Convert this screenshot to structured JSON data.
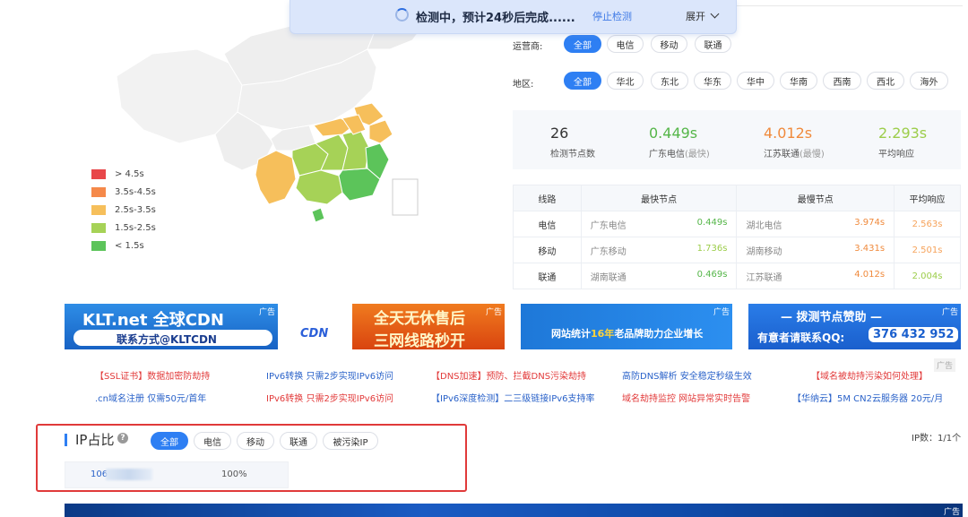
{
  "banner": {
    "status": "检测中，预计24秒后完成......",
    "stop": "停止检测",
    "expand": "展开"
  },
  "legend": [
    {
      "label": "> 4.5s",
      "color": "#e8474a"
    },
    {
      "label": "3.5s-4.5s",
      "color": "#f5894a"
    },
    {
      "label": "2.5s-3.5s",
      "color": "#f6bf5b"
    },
    {
      "label": "1.5s-2.5s",
      "color": "#a6d257"
    },
    {
      "label": "< 1.5s",
      "color": "#5cc45a"
    }
  ],
  "filters": {
    "isp_label": "运营商:",
    "isp": [
      "全部",
      "电信",
      "移动",
      "联通"
    ],
    "region_label": "地区:",
    "region": [
      "全部",
      "华北",
      "东北",
      "华东",
      "华中",
      "华南",
      "西南",
      "西北",
      "海外"
    ]
  },
  "stats": [
    {
      "value": "26",
      "label": "检测节点数",
      "note": "",
      "color": "#333333"
    },
    {
      "value": "0.449s",
      "label": "广东电信",
      "note": "(最快)",
      "color": "#55b649"
    },
    {
      "value": "4.012s",
      "label": "江苏联通",
      "note": "(最慢)",
      "color": "#f08a3c"
    },
    {
      "value": "2.293s",
      "label": "平均响应",
      "note": "",
      "color": "#9ccd4a"
    }
  ],
  "table": {
    "headers": [
      "线路",
      "最快节点",
      "最慢节点",
      "平均响应"
    ],
    "rows": [
      {
        "line": "电信",
        "fast_node": "广东电信",
        "fast_time": "0.449s",
        "slow_node": "湖北电信",
        "slow_time": "3.974s",
        "avg": "2.563s"
      },
      {
        "line": "移动",
        "fast_node": "广东移动",
        "fast_time": "1.736s",
        "slow_node": "湖南移动",
        "slow_time": "3.431s",
        "avg": "2.501s"
      },
      {
        "line": "联通",
        "fast_node": "湖南联通",
        "fast_time": "0.469s",
        "slow_node": "江苏联通",
        "slow_time": "4.012s",
        "avg": "2.004s"
      }
    ]
  },
  "ads": {
    "tag": "广告",
    "ad1_line1": "KLT.net 全球CDN",
    "ad1_line2": "联系方式@KLTCDN",
    "ad2_line1": "全天无休售后",
    "ad2_line2": "三网线路秒开",
    "ad2_logo": "CDN",
    "ad3_line1": "网站统计",
    "ad3_highlight": "16年",
    "ad3_line2": "老品牌助力企业增长",
    "ad4_line1": "— 拨测节点赞助 —",
    "ad4_line2": "有意者请联系QQ:",
    "ad4_qq": "376 432 952"
  },
  "text_ads": {
    "row1": [
      "【SSL证书】数据加密防劫持",
      "IPv6转换 只需2步实现IPv6访问",
      "【DNS加速】预防、拦截DNS污染劫持",
      "高防DNS解析 安全稳定秒级生效",
      "【域名被劫持污染如何处理】"
    ],
    "row2": [
      ".cn域名注册 仅需50元/首年",
      "IPv6转换 只需2步实现IPv6访问",
      "【IPv6深度检测】二三级链接IPv6支持率",
      "域名劫持监控 网站异常实时告警",
      "【华纳云】5M CN2云服务器 20元/月"
    ]
  },
  "ip": {
    "title": "IP占比",
    "tabs": [
      "全部",
      "电信",
      "移动",
      "联通",
      "被污染IP"
    ],
    "address": "106",
    "percent": "100%",
    "count": "IP数：1/1个"
  }
}
